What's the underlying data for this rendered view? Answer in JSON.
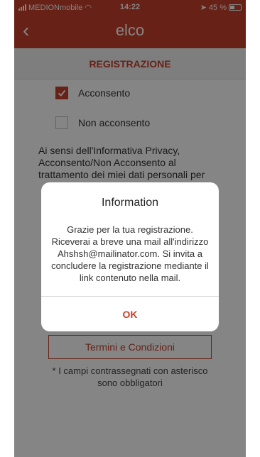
{
  "status_bar": {
    "carrier": "MEDIONmobile",
    "time": "14:22",
    "battery": "45 %",
    "battery_level": 0.45
  },
  "header": {
    "back_icon": "chevron-left-icon",
    "logo": "elco"
  },
  "section": {
    "title": "REGISTRAZIONE"
  },
  "form": {
    "consent_label": "Acconsento",
    "consent_checked": true,
    "no_consent_label": "Non acconsento",
    "no_consent_checked": false,
    "privacy_text": "Ai sensi dell'Informativa Privacy, Acconsento/Non Acconsento al trattamento dei miei dati personali per",
    "terms_button": "Termini e Condizioni",
    "required_note": "* I campi contrassegnati con asterisco sono obbligatori"
  },
  "dialog": {
    "title": "Information",
    "message": "Grazie per la tua registrazione. Riceverai a breve una mail all'indirizzo Ahshsh@mailinator.com. Si invita a concludere la registrazione mediante il link contenuto nella mail.",
    "ok_label": "OK"
  },
  "colors": {
    "brand": "#c6402b"
  }
}
